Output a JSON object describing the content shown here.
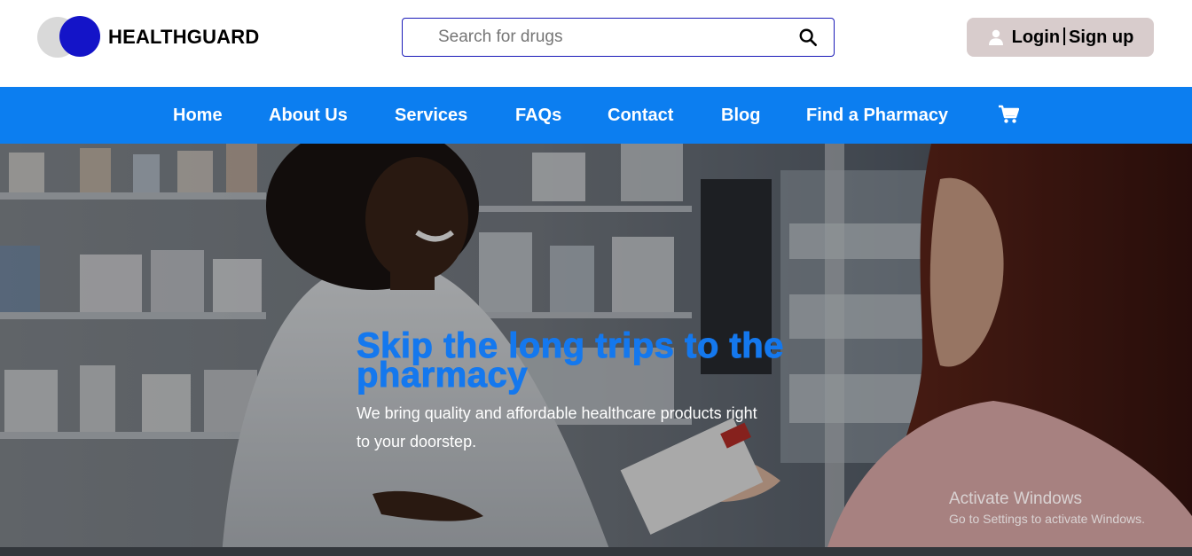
{
  "brand": {
    "name": "HEALTHGUARD"
  },
  "search": {
    "placeholder": "Search for drugs",
    "value": ""
  },
  "auth": {
    "login_label": "Login",
    "signup_label": "Sign up"
  },
  "nav": {
    "items": [
      {
        "label": "Home"
      },
      {
        "label": "About Us"
      },
      {
        "label": "Services"
      },
      {
        "label": "FAQs"
      },
      {
        "label": "Contact"
      },
      {
        "label": "Blog"
      },
      {
        "label": "Find a Pharmacy"
      }
    ],
    "cart_icon": "shopping-cart-icon"
  },
  "hero": {
    "title": "Skip the long trips to the pharmacy",
    "subtitle": "We bring quality and affordable healthcare products right to your doorstep."
  },
  "windows_watermark": {
    "title": "Activate Windows",
    "message": "Go to Settings to activate Windows."
  },
  "colors": {
    "brand_blue": "#1414c8",
    "nav_blue": "#0c7ef0",
    "hero_title": "#1478ee",
    "login_bg": "#d8cccc"
  }
}
